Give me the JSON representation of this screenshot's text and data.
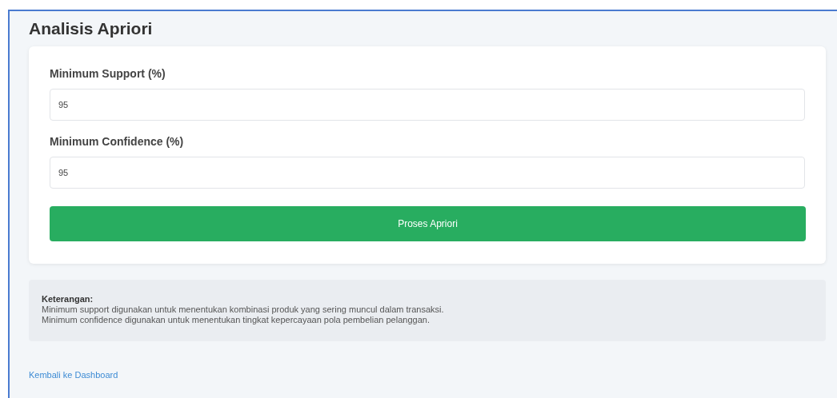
{
  "title": "Analisis Apriori",
  "form": {
    "fields": [
      {
        "label": "Minimum Support (%)",
        "value": "95"
      },
      {
        "label": "Minimum Confidence (%)",
        "value": "95"
      }
    ],
    "submit": "Proses Apriori"
  },
  "note": {
    "heading": "Keterangan:",
    "lines": [
      "Minimum support digunakan untuk menentukan kombinasi produk yang sering muncul dalam transaksi.",
      "Minimum confidence digunakan untuk menentukan tingkat kepercayaan pola pembelian pelanggan."
    ]
  },
  "back_link": "Kembali ke Dashboard"
}
